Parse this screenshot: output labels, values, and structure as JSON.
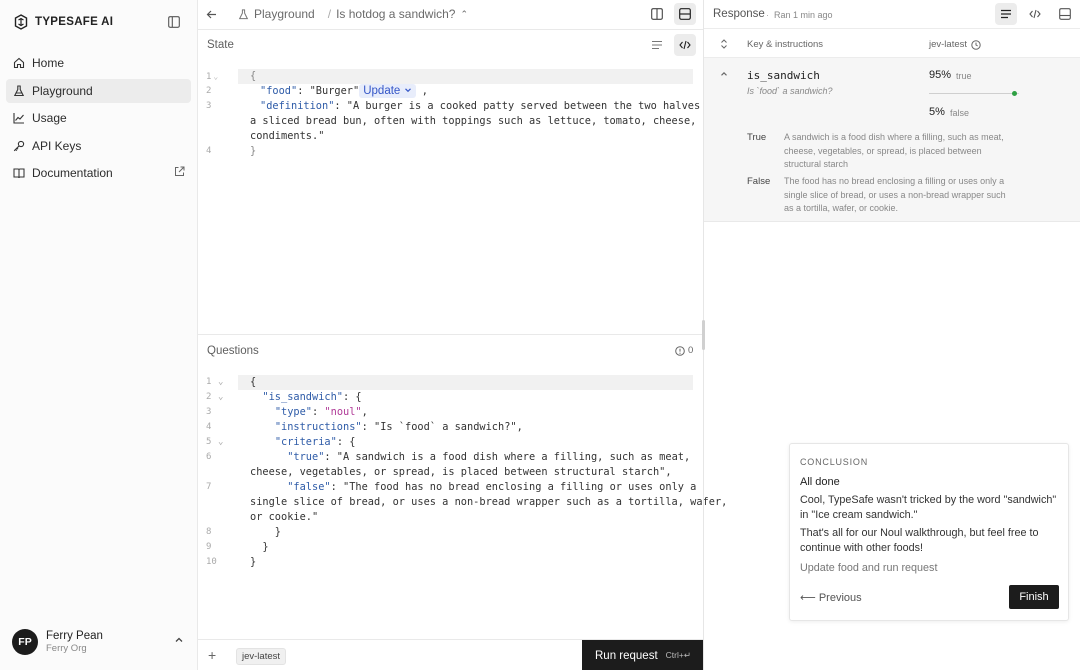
{
  "sidebar": {
    "brand": "TYPESAFE AI",
    "items": [
      {
        "label": "Home",
        "icon": "home-icon"
      },
      {
        "label": "Playground",
        "icon": "flask-icon",
        "active": true
      },
      {
        "label": "Usage",
        "icon": "chart-line-icon"
      },
      {
        "label": "API Keys",
        "icon": "key-icon"
      },
      {
        "label": "Documentation",
        "icon": "book-icon"
      }
    ],
    "user": {
      "initials": "FP",
      "name": "Ferry Pean",
      "org": "Ferry Org"
    }
  },
  "topbar": {
    "crumb_root": "Playground",
    "crumb_sep": "/",
    "crumb_current": "Is hotdog a sandwich?",
    "crumb_current_suffix": "⌃"
  },
  "state": {
    "title": "State",
    "lines": [
      {
        "n": "1",
        "fold": true
      },
      {
        "n": "2"
      },
      {
        "n": "3"
      },
      {
        "n": ""
      },
      {
        "n": ""
      },
      {
        "n": "4"
      }
    ],
    "tokens": {
      "open": "{",
      "food_key": "\"food\"",
      "colon": ": ",
      "food_val": "\"Burger\"",
      "update": "Update",
      "comma": ",",
      "def_key": "\"definition\"",
      "def_line1": ": \"A burger is a cooked patty served between the two halves of",
      "def_line2": "a sliced bread bun, often with toppings such as lettuce, tomato, cheese, and",
      "def_line3": "condiments.\"",
      "close": "}"
    }
  },
  "questions": {
    "title": "Questions",
    "count": "0",
    "lines": [
      "1",
      "2",
      "3",
      "4",
      "5",
      "6",
      "",
      "7",
      "",
      "",
      "8",
      "9",
      "10"
    ],
    "code": [
      "{",
      "  \"is_sandwich\": {",
      "    \"type\": \"noul\",",
      "    \"instructions\": \"Is `food` a sandwich?\",",
      "    \"criteria\": {",
      "      \"true\": \"A sandwich is a food dish where a filling, such as meat,",
      "cheese, vegetables, or spread, is placed between structural starch\",",
      "      \"false\": \"The food has no bread enclosing a filling or uses only a",
      "single slice of bread, or uses a non-bread wrapper such as a tortilla, wafer,",
      "or cookie.\"",
      "    }",
      "  }",
      "}"
    ]
  },
  "bottom": {
    "plus": "+",
    "version": "jev-latest",
    "run_label": "Run request",
    "run_shortcut": "Ctrl+↵"
  },
  "response": {
    "title": "Response",
    "dot": "·",
    "ran": "Ran 1 min ago",
    "col_key": "Key & instructions",
    "col_version": "jev-latest",
    "row": {
      "key": "is_sandwich",
      "instruction": "Is `food` a sandwich?",
      "true_pct": "95%",
      "true_word": "true",
      "false_pct": "5%",
      "false_word": "false",
      "true_fraction": 0.95,
      "crit_true_label": "True",
      "crit_true_text": "A sandwich is a food dish where a filling, such as meat, cheese, vegetables, or spread, is placed between structural starch",
      "crit_false_label": "False",
      "crit_false_text": "The food has no bread enclosing a filling or uses only a single slice of bread, or uses a non-bread wrapper such as a tortilla, wafer, or cookie."
    }
  },
  "conclusion": {
    "label": "CONCLUSION",
    "title": "All done",
    "p1": "Cool, TypeSafe wasn't tricked by the word \"sandwich\" in \"Ice cream sandwich.\"",
    "p2": "That's all for our Noul walkthrough, but feel free to continue with other foods!",
    "hint": "Update food and run request",
    "prev": "⟵ Previous",
    "finish": "Finish"
  },
  "colors": {
    "accent": "#3456c7",
    "dark": "#1c1c1c",
    "string_purple": "#b03a97",
    "success": "#2ea043"
  }
}
